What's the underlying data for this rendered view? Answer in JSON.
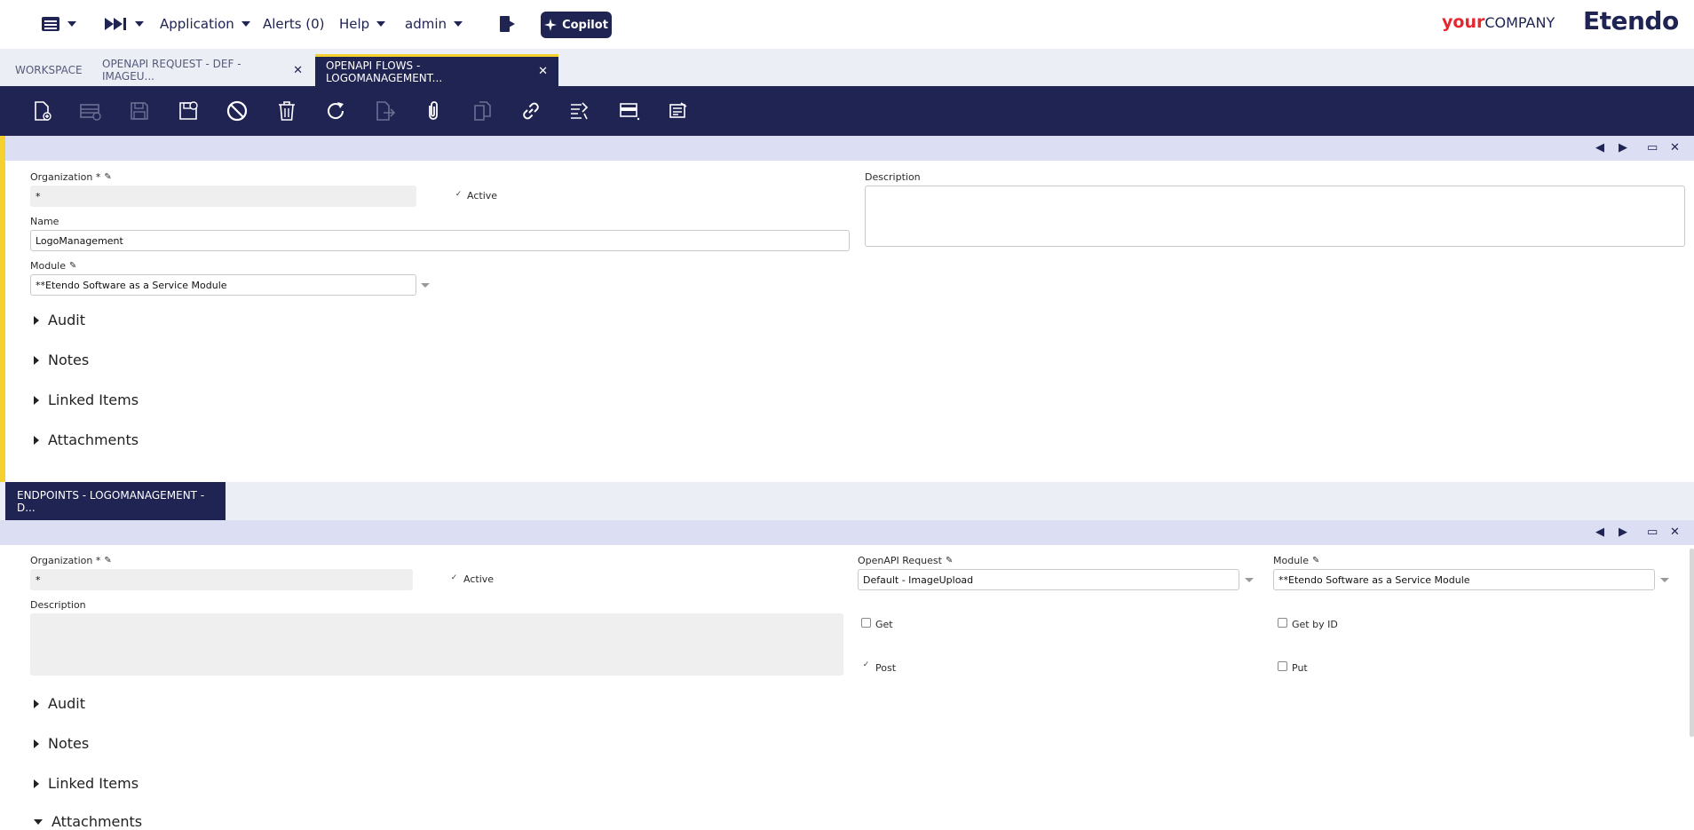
{
  "nav": {
    "application": "Application",
    "alerts": "Alerts (0)",
    "help": "Help",
    "user": "admin",
    "copilot": "Copilot"
  },
  "brand": {
    "your": "your",
    "company": "COMPANY",
    "etendo": "Etendo",
    "accent": "#e8262d",
    "primary": "#202452",
    "highlight": "#f5d130"
  },
  "tabs": [
    {
      "label": "WORKSPACE"
    },
    {
      "label": "OPENAPI REQUEST - DEF - IMAGEU..."
    },
    {
      "label": "OPENAPI FLOWS - LOGOMANAGEMENT..."
    }
  ],
  "toolbar": [
    {
      "icon": "new-record-icon"
    },
    {
      "icon": "new-row-icon"
    },
    {
      "icon": "save-icon"
    },
    {
      "icon": "save-close-icon"
    },
    {
      "icon": "undo-icon"
    },
    {
      "icon": "delete-icon"
    },
    {
      "icon": "refresh-icon"
    },
    {
      "icon": "export-icon"
    },
    {
      "icon": "attachment-icon"
    },
    {
      "icon": "clone-icon"
    },
    {
      "icon": "link-icon"
    },
    {
      "icon": "audit-trail-icon"
    },
    {
      "icon": "grid-view-icon"
    },
    {
      "icon": "notes-icon"
    }
  ],
  "header_form": {
    "organization_label": "Organization *",
    "organization_value": "*",
    "active_label": "Active",
    "description_label": "Description",
    "name_label": "Name",
    "name_value": "LogoManagement",
    "module_label": "Module",
    "module_value": "**Etendo Software as a Service Module",
    "sections": [
      "Audit",
      "Notes",
      "Linked Items",
      "Attachments"
    ]
  },
  "subtab": {
    "label": "ENDPOINTS - LOGOMANAGEMENT - D..."
  },
  "endpoint_form": {
    "organization_label": "Organization *",
    "organization_value": "*",
    "active_label": "Active",
    "openapi_request_label": "OpenAPI Request",
    "openapi_request_value": "Default - ImageUpload",
    "module_label": "Module",
    "module_value": "**Etendo Software as a Service Module",
    "description_label": "Description",
    "get_label": "Get",
    "get_by_id_label": "Get by ID",
    "post_label": "Post",
    "put_label": "Put",
    "sections": [
      "Audit",
      "Notes",
      "Linked Items",
      "Attachments"
    ]
  }
}
